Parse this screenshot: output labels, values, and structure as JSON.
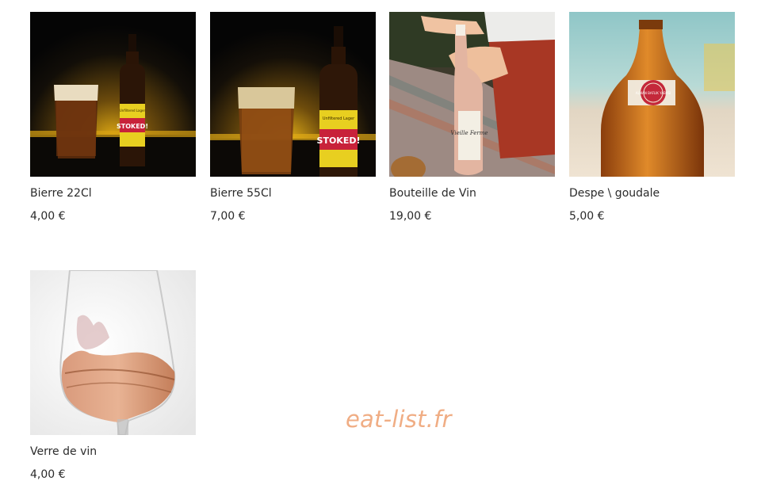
{
  "products": [
    {
      "name": "Bierre 22Cl",
      "price": "4,00 €",
      "image": "beer-22cl-photo"
    },
    {
      "name": "Bierre 55Cl",
      "price": "7,00 €",
      "image": "beer-55cl-photo"
    },
    {
      "name": "Bouteille de Vin",
      "price": "19,00 €",
      "image": "wine-bottle-photo"
    },
    {
      "name": "Despe \\ goudale",
      "price": "5,00 €",
      "image": "goudale-bottle-photo"
    },
    {
      "name": "Verre de vin",
      "price": "4,00 €",
      "image": "wine-glass-photo"
    }
  ],
  "watermark": {
    "text": "eat-list.fr",
    "color": "#f0ad84"
  },
  "photo_text": {
    "label_brand": "STOKED!",
    "label_top": "Unfiltered Lager",
    "wine_label": "Vieille Ferme",
    "goudale_label": "ALMAN BAFLIK YABASI"
  }
}
